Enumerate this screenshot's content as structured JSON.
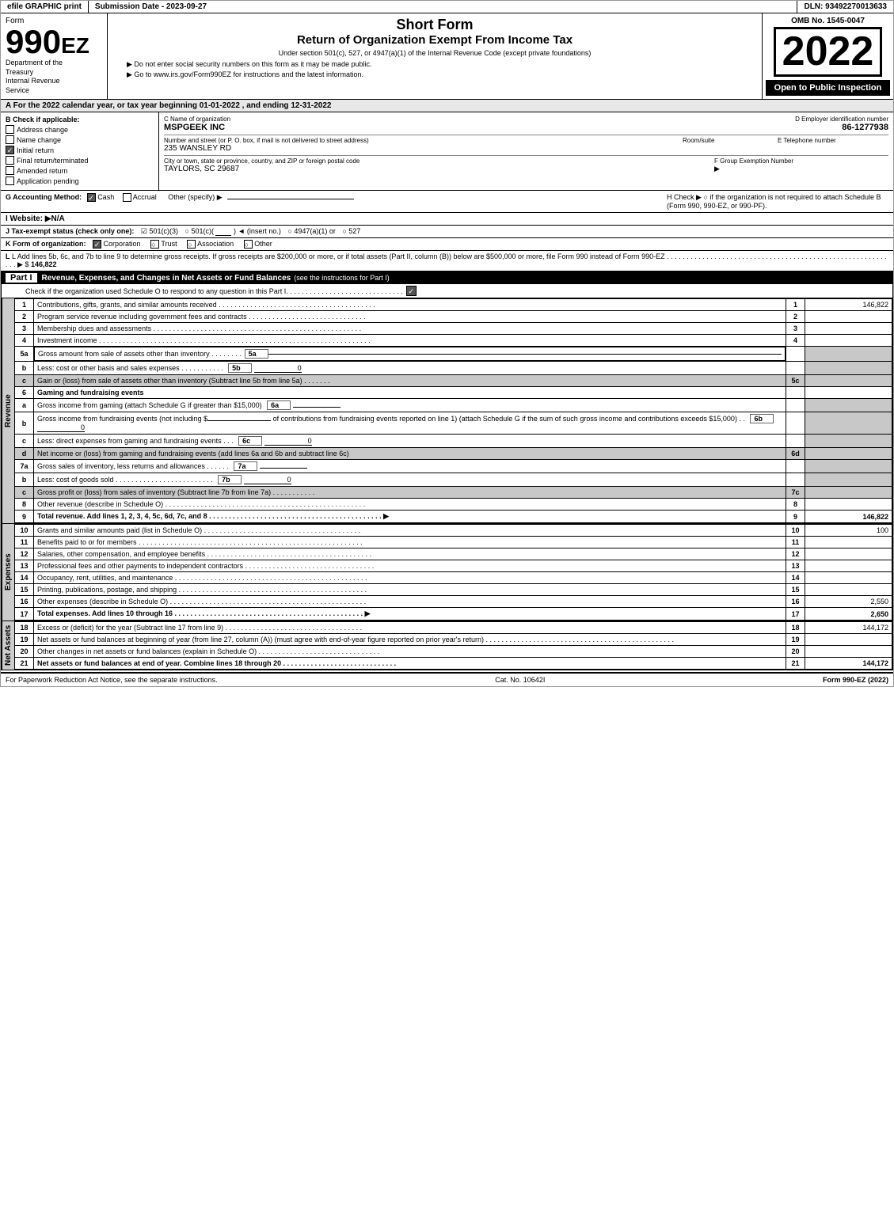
{
  "header": {
    "efile_label": "efile GRAPHIC print",
    "submission_label": "Submission Date - 2023-09-27",
    "dln_label": "DLN: 93492270013633",
    "omb_label": "OMB No. 1545-0047",
    "form_number": "990EZ",
    "form_department1": "Department of the",
    "form_department2": "Treasury",
    "form_department3": "Internal Revenue",
    "form_department4": "Service",
    "short_form_title": "Short Form",
    "return_title": "Return of Organization Exempt From Income Tax",
    "under_section": "Under section 501(c), 527, or 4947(a)(1) of the Internal Revenue Code (except private foundations)",
    "ssn_notice": "▶ Do not enter social security numbers on this form as it may be made public.",
    "goto_notice": "▶ Go to www.irs.gov/Form990EZ for instructions and the latest information.",
    "year": "2022",
    "open_to_public": "Open to Public Inspection"
  },
  "section_a": {
    "label": "A For the 2022 calendar year, or tax year beginning 01-01-2022 , and ending 12-31-2022"
  },
  "section_b": {
    "label": "B Check if applicable:",
    "address_change": "Address change",
    "name_change": "Name change",
    "initial_return": "Initial return",
    "final_return": "Final return/terminated",
    "amended_return": "Amended return",
    "application_pending": "Application pending",
    "address_change_checked": false,
    "name_change_checked": false,
    "initial_return_checked": true,
    "final_return_checked": false,
    "amended_return_checked": false,
    "application_pending_checked": false
  },
  "section_c": {
    "label": "C Name of organization",
    "org_name": "MSPGEEK INC"
  },
  "section_d": {
    "label": "D Employer identification number",
    "ein": "86-1277938"
  },
  "section_e": {
    "label": "E Telephone number"
  },
  "address": {
    "label": "Number and street (or P. O. box, if mail is not delivered to street address)",
    "street": "235 WANSLEY RD",
    "room_label": "Room/suite"
  },
  "city": {
    "label": "City or town, state or province, country, and ZIP or foreign postal code",
    "city_state_zip": "TAYLORS, SC  29687"
  },
  "section_f": {
    "label": "F Group Exemption Number",
    "arrow": "▶"
  },
  "section_g": {
    "label": "G Accounting Method:",
    "cash_checked": true,
    "accrual_checked": false,
    "cash_label": "Cash",
    "accrual_label": "Accrual",
    "other_label": "Other (specify) ▶"
  },
  "section_h": {
    "label": "H Check ▶",
    "text": "○ if the organization is not required to attach Schedule B (Form 990, 990-EZ, or 990-PF)."
  },
  "section_i": {
    "label": "I Website: ▶N/A"
  },
  "section_j": {
    "label": "J Tax-exempt status (check only one):",
    "status_501c3": "☑ 501(c)(3)",
    "status_501c": "○ 501(c)(",
    "insert": ") ◄ (insert no.)",
    "status_4947": "○ 4947(a)(1) or",
    "status_527": "○ 527"
  },
  "section_k": {
    "label": "K Form of organization:",
    "corporation_checked": true,
    "trust_checked": false,
    "association_checked": false,
    "other_checked": false,
    "corporation_label": "Corporation",
    "trust_label": "Trust",
    "association_label": "Association",
    "other_label": "Other"
  },
  "section_l": {
    "text": "L Add lines 5b, 6c, and 7b to line 9 to determine gross receipts. If gross receipts are $200,000 or more, or if total assets (Part II, column (B)) below are $500,000 or more, file Form 990 instead of Form 990-EZ",
    "dots": ". . . . . . . . . . . . . . . . . . . . . . . . . . . . . . . . . . . . . . . . . . . . . . . . . . . . . . . . . . .",
    "arrow": "▶ $",
    "amount": "146,822"
  },
  "part_i": {
    "label": "Part I",
    "title": "Revenue, Expenses, and Changes in Net Assets or Fund Balances",
    "see_instructions": "(see the instructions for Part I)",
    "check_line": "Check if the organization used Schedule O to respond to any question in this Part I",
    "check_dots": ". . . . . . . . . . . . . . . . . . . . . . . . . . . . . .",
    "rows": [
      {
        "num": "1",
        "desc": "Contributions, gifts, grants, and similar amounts received",
        "dots": ". . . . . . . . . . . . . . . . . . . . . . . . . . . . . . . . . . . . . . . .",
        "line": "1",
        "amount": "146,822",
        "shaded": false
      },
      {
        "num": "2",
        "desc": "Program service revenue including government fees and contracts",
        "dots": ". . . . . . . . . . . . . . . . . . . . . . . . . . . . . .",
        "line": "2",
        "amount": "",
        "shaded": false
      },
      {
        "num": "3",
        "desc": "Membership dues and assessments",
        "dots": ". . . . . . . . . . . . . . . . . . . . . . . . . . . . . . . . . . . . . . . . . . . . . . . . . . . . . .",
        "line": "3",
        "amount": "",
        "shaded": false
      },
      {
        "num": "4",
        "desc": "Investment income",
        "dots": ". . . . . . . . . . . . . . . . . . . . . . . . . . . . . . . . . . . . . . . . . . . . . . . . . . . . . . . . . . . . . . . . . . . . . . . . . . . . .",
        "line": "4",
        "amount": "",
        "shaded": false
      },
      {
        "num": "5a",
        "desc": "Gross amount from sale of assets other than inventory",
        "dots": ". . . . . . . .",
        "line": "5a",
        "amount": "",
        "shaded": false,
        "sub": true
      },
      {
        "num": "b",
        "desc": "Less: cost or other basis and sales expenses",
        "dots": ". . . . . . . . . . .",
        "line": "5b",
        "amount": "0",
        "shaded": false,
        "sub": true
      },
      {
        "num": "c",
        "desc": "Gain or (loss) from sale of assets other than inventory (Subtract line 5b from line 5a)",
        "dots": ". . . . . . .",
        "line": "5c",
        "amount": "",
        "shaded": true,
        "sub": true
      },
      {
        "num": "6",
        "desc": "Gaming and fundraising events",
        "dots": "",
        "line": "",
        "amount": "",
        "shaded": false
      },
      {
        "num": "a",
        "desc": "Gross income from gaming (attach Schedule G if greater than $15,000)",
        "dots": "",
        "line": "6a",
        "amount": "",
        "shaded": false,
        "sub": true
      },
      {
        "num": "b",
        "desc": "Gross income from fundraising events (not including $                  of contributions from fundraising events reported on line 1) (attach Schedule G if the sum of such gross income and contributions exceeds $15,000)",
        "dots": ". .",
        "line": "6b",
        "amount": "0",
        "shaded": false,
        "sub": true
      },
      {
        "num": "c",
        "desc": "Less: direct expenses from gaming and fundraising events",
        "dots": ". . .",
        "line": "6c",
        "amount": "0",
        "shaded": false,
        "sub": true
      },
      {
        "num": "d",
        "desc": "Net income or (loss) from gaming and fundraising events (add lines 6a and 6b and subtract line 6c)",
        "dots": "",
        "line": "6d",
        "amount": "",
        "shaded": true,
        "sub": true
      },
      {
        "num": "7a",
        "desc": "Gross sales of inventory, less returns and allowances",
        "dots": ". . . . . .",
        "line": "7a",
        "amount": "",
        "shaded": false,
        "sub": true
      },
      {
        "num": "b",
        "desc": "Less: cost of goods sold",
        "dots": ". . . . . . . . . . . . . . . . . . . . . . . .",
        "line": "7b",
        "amount": "0",
        "shaded": false,
        "sub": true
      },
      {
        "num": "c",
        "desc": "Gross profit or (loss) from sales of inventory (Subtract line 7b from line 7a)",
        "dots": ". . . . . . . . . . .",
        "line": "7c",
        "amount": "",
        "shaded": true,
        "sub": true
      },
      {
        "num": "8",
        "desc": "Other revenue (describe in Schedule O)",
        "dots": ". . . . . . . . . . . . . . . . . . . . . . . . . . . . . . . . . . . . . . . . . . . . . . . . . . . . .",
        "line": "8",
        "amount": "",
        "shaded": false
      },
      {
        "num": "9",
        "desc": "Total revenue. Add lines 1, 2, 3, 4, 5c, 6d, 7c, and 8",
        "dots": ". . . . . . . . . . . . . . . . . . . . . . . . . . . . . . . . . . . . . . . . . . . .",
        "arrow": "▶",
        "line": "9",
        "amount": "146,822",
        "shaded": false,
        "bold": true
      }
    ]
  },
  "part_i_expenses": {
    "rows": [
      {
        "num": "10",
        "desc": "Grants and similar amounts paid (list in Schedule O)",
        "dots": ". . . . . . . . . . . . . . . . . . . . . . . . . . . . . . . . . . . . . . . . .",
        "line": "10",
        "amount": "100",
        "shaded": false
      },
      {
        "num": "11",
        "desc": "Benefits paid to or for members",
        "dots": ". . . . . . . . . . . . . . . . . . . . . . . . . . . . . . . . . . . . . . . . . . . . . . . . . . . . . . . . . . . . .",
        "line": "11",
        "amount": "",
        "shaded": false
      },
      {
        "num": "12",
        "desc": "Salaries, other compensation, and employee benefits",
        "dots": ". . . . . . . . . . . . . . . . . . . . . . . . . . . . . . . . . . . . . . . . . . . .",
        "line": "12",
        "amount": "",
        "shaded": false
      },
      {
        "num": "13",
        "desc": "Professional fees and other payments to independent contractors",
        "dots": ". . . . . . . . . . . . . . . . . . . . . . . . . . . . . . . . . . . . . . .",
        "line": "13",
        "amount": "",
        "shaded": false
      },
      {
        "num": "14",
        "desc": "Occupancy, rent, utilities, and maintenance",
        "dots": ". . . . . . . . . . . . . . . . . . . . . . . . . . . . . . . . . . . . . . . . . . . . . . . . . . . . . .",
        "line": "14",
        "amount": "",
        "shaded": false
      },
      {
        "num": "15",
        "desc": "Printing, publications, postage, and shipping",
        "dots": ". . . . . . . . . . . . . . . . . . . . . . . . . . . . . . . . . . . . . . . . . . . . . . . . . . . . . . .",
        "line": "15",
        "amount": "",
        "shaded": false
      },
      {
        "num": "16",
        "desc": "Other expenses (describe in Schedule O)",
        "dots": ". . . . . . . . . . . . . . . . . . . . . . . . . . . . . . . . . . . . . . . . . . . . . . . . . . . . . . . .",
        "line": "16",
        "amount": "2,550",
        "shaded": false
      },
      {
        "num": "17",
        "desc": "Total expenses. Add lines 10 through 16",
        "dots": ". . . . . . . . . . . . . . . . . . . . . . . . . . . . . . . . . . . . . . . . . . . . . . . . . . . . .",
        "arrow": "▶",
        "line": "17",
        "amount": "2,650",
        "shaded": false,
        "bold": true
      }
    ]
  },
  "part_i_assets": {
    "rows": [
      {
        "num": "18",
        "desc": "Excess or (deficit) for the year (Subtract line 17 from line 9)",
        "dots": ". . . . . . . . . . . . . . . . . . . . . . . . . . . . . . . . . . . .",
        "line": "18",
        "amount": "144,172",
        "shaded": false
      },
      {
        "num": "19",
        "desc": "Net assets or fund balances at beginning of year (from line 27, column (A)) (must agree with end-of-year figure reported on prior year's return)",
        "dots": ". . . . . . . . . . . . . . . . . . . . . . . . . . . . . . . . . . . . . . . . . . . . . . . . .",
        "line": "19",
        "amount": "",
        "shaded": false
      },
      {
        "num": "20",
        "desc": "Other changes in net assets or fund balances (explain in Schedule O)",
        "dots": ". . . . . . . . . . . . . . . . . . . . . . . . . . . . . . . . . . . . . . . . .",
        "line": "20",
        "amount": "",
        "shaded": false
      },
      {
        "num": "21",
        "desc": "Net assets or fund balances at end of year. Combine lines 18 through 20",
        "dots": ". . . . . . . . . . . . . . . . . . . . . . . . . . . . . . . . . . . . .",
        "line": "21",
        "amount": "144,172",
        "shaded": false,
        "bold": true
      }
    ]
  },
  "footer": {
    "paperwork_notice": "For Paperwork Reduction Act Notice, see the separate instructions.",
    "cat_no": "Cat. No. 10642I",
    "form_label": "Form 990-EZ (2022)"
  }
}
